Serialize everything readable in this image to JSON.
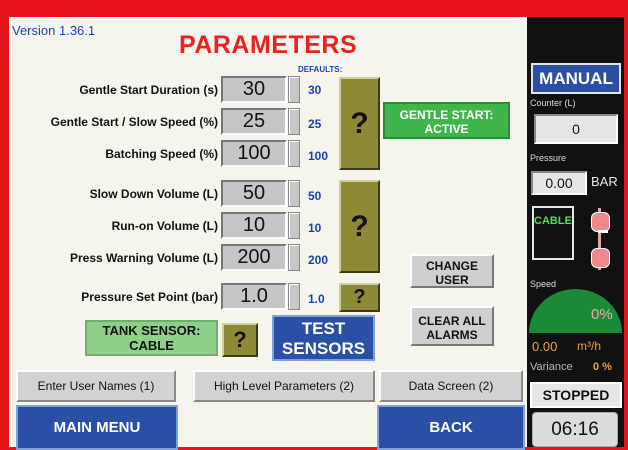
{
  "header": {
    "version": "Version 1.36.1",
    "title": "PARAMETERS",
    "defaults_label": "DEFAULTS:"
  },
  "params": [
    {
      "label": "Gentle Start Duration (s)",
      "value": "30",
      "default": "30"
    },
    {
      "label": "Gentle Start / Slow Speed (%)",
      "value": "25",
      "default": "25"
    },
    {
      "label": "Batching Speed (%)",
      "value": "100",
      "default": "100"
    },
    {
      "label": "Slow Down Volume (L)",
      "value": "50",
      "default": "50"
    },
    {
      "label": "Run-on Volume (L)",
      "value": "10",
      "default": "10"
    },
    {
      "label": "Press Warning Volume (L)",
      "value": "200",
      "default": "200"
    },
    {
      "label": "Pressure Set Point (bar)",
      "value": "1.0",
      "default": "1.0"
    }
  ],
  "help_label": "?",
  "gentle_start_status": {
    "line1": "GENTLE START:",
    "line2": "ACTIVE"
  },
  "buttons": {
    "change_user": {
      "line1": "CHANGE",
      "line2": "USER"
    },
    "clear_alarms": {
      "line1": "CLEAR ALL",
      "line2": "ALARMS"
    },
    "test_sensors": {
      "line1": "TEST",
      "line2": "SENSORS"
    }
  },
  "tank_sensor": {
    "line1": "TANK SENSOR:",
    "line2": "CABLE"
  },
  "tabs": [
    "Enter User Names (1)",
    "High Level Parameters (2)",
    "Data Screen (2)"
  ],
  "nav": {
    "main_menu": "MAIN MENU",
    "back": "BACK"
  },
  "sidebar": {
    "mode": "MANUAL",
    "counter_label": "Counter (L)",
    "counter_value": "0",
    "pressure_label": "Pressure",
    "pressure_value": "0.00",
    "pressure_unit": "BAR",
    "cable_label": "CABLE",
    "speed_label": "Speed",
    "speed_value": "0%",
    "flow_value": "0.00",
    "flow_unit": "m³/h",
    "variance_label": "Variance",
    "variance_value": "0 %",
    "status": "STOPPED",
    "time": "06:16"
  },
  "colors": {
    "frame": "#e8141b",
    "accent_blue": "#2a4fa5",
    "title_red": "#e8231f",
    "status_green": "#40b54c",
    "help_olive": "#8c8a34"
  }
}
